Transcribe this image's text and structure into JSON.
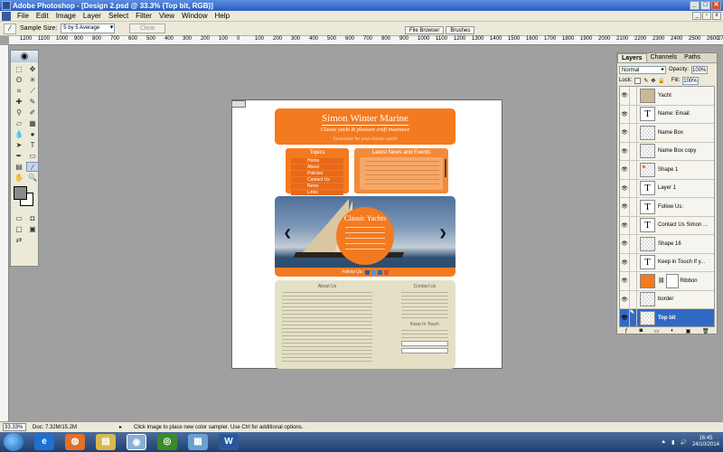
{
  "window": {
    "title": "Adobe Photoshop - [Design 2.psd @ 33.3% (Top bit, RGB)]",
    "controls": [
      "_",
      "□",
      "✕"
    ]
  },
  "menu": {
    "items": [
      "File",
      "Edit",
      "Image",
      "Layer",
      "Select",
      "Filter",
      "View",
      "Window",
      "Help"
    ]
  },
  "options": {
    "sample_label": "Sample Size:",
    "sample_value": "5 by 5 Average",
    "clear_label": "Clear"
  },
  "palette_well": {
    "file_browser": "File Browser",
    "brushes": "Brushes"
  },
  "ruler": {
    "top_ticks": [
      "1200",
      "1100",
      "1000",
      "900",
      "800",
      "700",
      "600",
      "500",
      "400",
      "300",
      "200",
      "100",
      "0",
      "100",
      "200",
      "300",
      "400",
      "500",
      "600",
      "700",
      "800",
      "900",
      "1000",
      "1100",
      "1200",
      "1300",
      "1400",
      "1500",
      "1600",
      "1700",
      "1800",
      "1900",
      "2000",
      "2100",
      "2200",
      "2300",
      "2400",
      "2500",
      "2600",
      "2700"
    ]
  },
  "design": {
    "title": "Simon Winter Marine",
    "subtitle": "Classic yacht & pleasure craft insurance",
    "tagline": "Insurance for your classic yacht",
    "left_box_heading": "Topics",
    "left_links": [
      "Home",
      "About",
      "Policies",
      "Contact Us",
      "News",
      "Links"
    ],
    "right_box_heading": "Latest News and Events",
    "slide_title": "Classic Yachts",
    "follow_label": "Follow Us:",
    "about_heading": "About Us",
    "contact_heading": "Contact Us",
    "keep_in_touch": "Keep In Touch"
  },
  "layers_panel": {
    "tabs": [
      "Layers",
      "Channels",
      "Paths"
    ],
    "blend_mode": "Normal",
    "opacity_label": "Opacity:",
    "opacity_value": "100%",
    "lock_label": "Lock:",
    "fill_label": "Fill:",
    "fill_value": "100%",
    "layers": [
      {
        "name": "Yacht",
        "thumb": "image",
        "selected": false
      },
      {
        "name": "Name:  Email:",
        "thumb": "text",
        "selected": false
      },
      {
        "name": "Name Box",
        "thumb": "empty",
        "selected": false
      },
      {
        "name": "Name Box copy",
        "thumb": "empty",
        "selected": false
      },
      {
        "name": "Shape 1",
        "thumb": "dot",
        "selected": false
      },
      {
        "name": "Layer 1",
        "thumb": "text",
        "selected": false
      },
      {
        "name": "Follow Us:",
        "thumb": "text",
        "selected": false
      },
      {
        "name": "Contact Us Simon ...",
        "thumb": "text",
        "selected": false
      },
      {
        "name": "Shape 16",
        "thumb": "empty",
        "selected": false
      },
      {
        "name": "Keep in Touch If y...",
        "thumb": "text",
        "selected": false
      },
      {
        "name": "Ribbon",
        "thumb": "orange",
        "selected": false
      },
      {
        "name": "border",
        "thumb": "empty",
        "selected": false
      },
      {
        "name": "Top bit",
        "thumb": "empty",
        "selected": true
      }
    ]
  },
  "status": {
    "zoom": "33.33%",
    "doc_info": "Doc: 7.32M/15.2M",
    "hint": "Click image to place new color sampler.  Use Ctrl for additional options."
  },
  "taskbar": {
    "time": "16:45",
    "date": "24/10/2014"
  },
  "colors": {
    "orange": "#f47a20",
    "selected_layer": "#316ac5",
    "canvas_bg": "#a0a0a0"
  }
}
